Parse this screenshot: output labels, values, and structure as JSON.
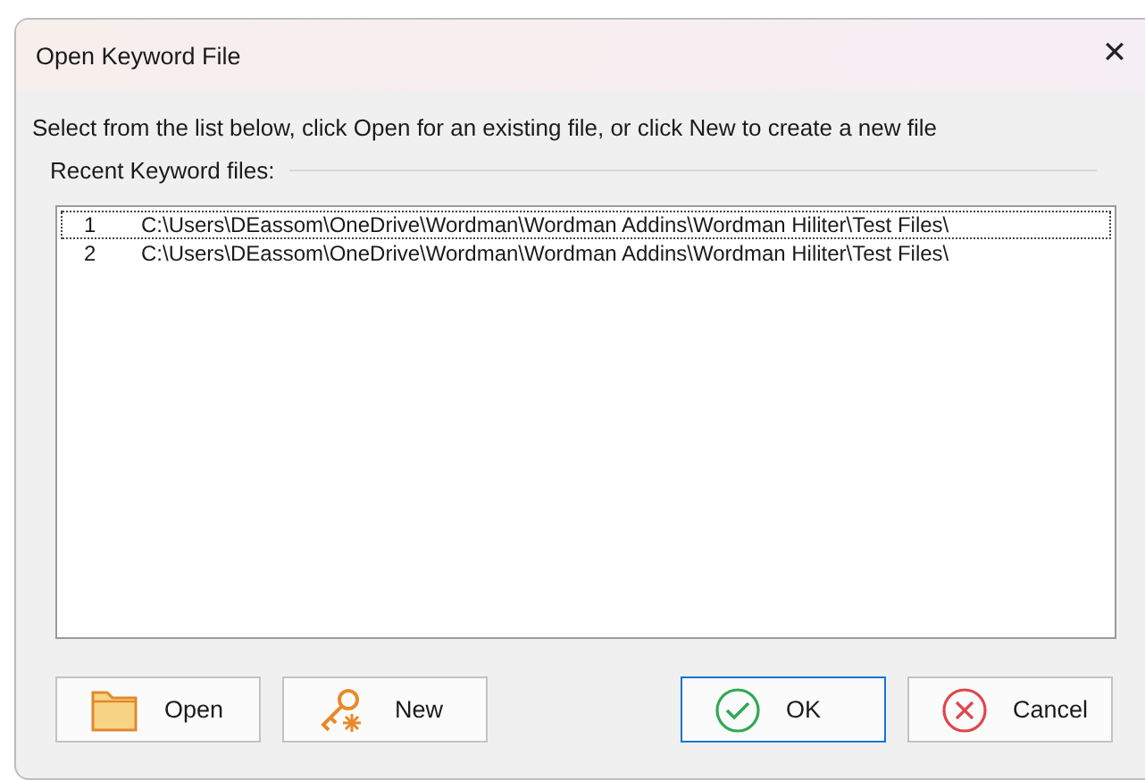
{
  "window": {
    "title": "Open Keyword File",
    "close": "✕"
  },
  "instruction": "Select from the list below, click Open for an existing file, or click New to create a new file",
  "group": {
    "label": "Recent Keyword files:"
  },
  "files": [
    {
      "number": "1",
      "path": "C:\\Users\\DEassom\\OneDrive\\Wordman\\Wordman Addins\\Wordman Hiliter\\Test Files\\",
      "focused": true
    },
    {
      "number": "2",
      "path": "C:\\Users\\DEassom\\OneDrive\\Wordman\\Wordman Addins\\Wordman Hiliter\\Test Files\\",
      "focused": false
    }
  ],
  "buttons": [
    {
      "kind": "open",
      "label": "Open",
      "default": false
    },
    {
      "kind": "new",
      "label": "New",
      "default": false
    },
    {
      "kind": "ok",
      "label": "OK",
      "default": true
    },
    {
      "kind": "cancel",
      "label": "Cancel",
      "default": false
    }
  ]
}
